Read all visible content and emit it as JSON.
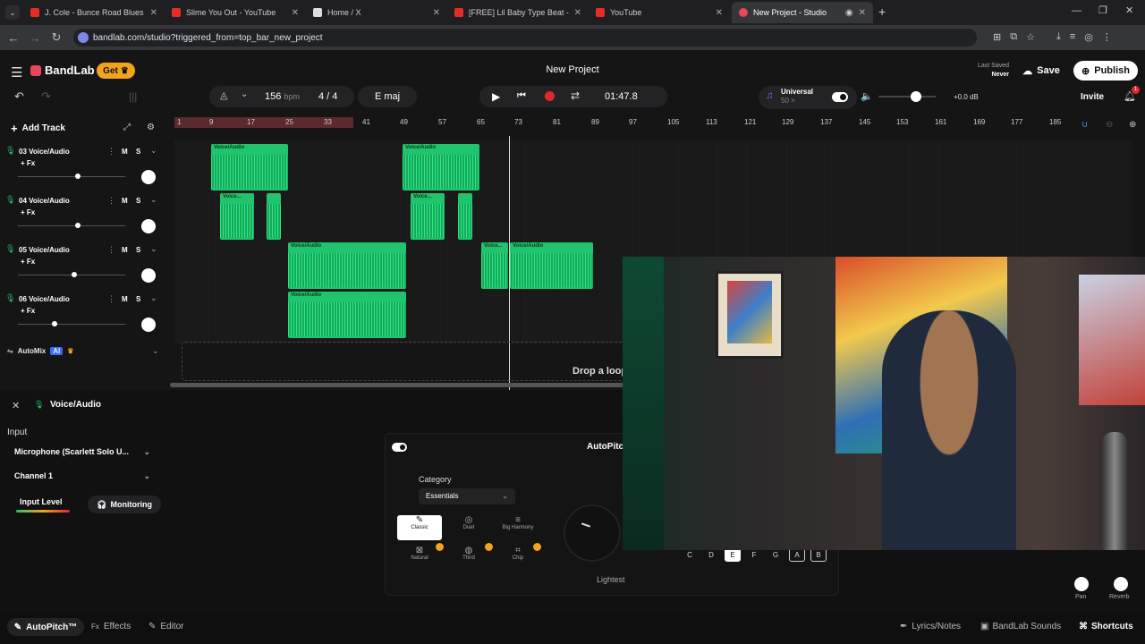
{
  "browser": {
    "tabs": [
      {
        "title": "J. Cole - Bunce Road Blues [Ins",
        "color": "#e52d27"
      },
      {
        "title": "Slime You Out - YouTube",
        "color": "#e52d27"
      },
      {
        "title": "Home / X",
        "color": "#dddddd"
      },
      {
        "title": "[FREE] Lil Baby Type Beat - \"Ne",
        "color": "#e52d27"
      },
      {
        "title": "YouTube",
        "color": "#e52d27"
      },
      {
        "title": "New Project - Studio",
        "color": "#e8465b"
      }
    ],
    "url": "bandlab.com/studio?triggered_from=top_bar_new_project"
  },
  "header": {
    "logo": "BandLab",
    "get_label": "Get",
    "project_title": "New Project",
    "last_saved_label": "Last Saved",
    "last_saved_value": "Never",
    "save_label": "Save",
    "publish_label": "Publish"
  },
  "transport": {
    "bpm": "156",
    "bpm_unit": "bpm",
    "time_sig": "4 / 4",
    "key": "E maj",
    "time": "01:47.8",
    "preset_name": "Universal",
    "preset_sub": "50 >",
    "volume_db": "+0.0 dB",
    "invite_label": "Invite",
    "notif_count": "1"
  },
  "tracks_panel": {
    "add_track_label": "Add Track",
    "automix_label": "AutoMix",
    "automix_badge": "AI",
    "fx_label": "+ Fx",
    "mute": "M",
    "solo": "S",
    "tracks": [
      {
        "name": "03  Voice/Audio"
      },
      {
        "name": "04  Voice/Audio"
      },
      {
        "name": "05  Voice/Audio"
      },
      {
        "name": "06  Voice/Audio"
      }
    ]
  },
  "ruler": [
    "1",
    "9",
    "17",
    "25",
    "33",
    "41",
    "49",
    "57",
    "65",
    "73",
    "81",
    "89",
    "97",
    "105",
    "113",
    "121",
    "129",
    "137",
    "145",
    "153",
    "161",
    "169",
    "177",
    "185"
  ],
  "clip_labels": {
    "voice_audio": "Voice/Audio",
    "voice_short": "Voice..."
  },
  "drop_loop_label": "Drop a loop",
  "bottom_panel": {
    "track_title": "Voice/Audio",
    "input_label": "Input",
    "mic_value": "Microphone (Scarlett Solo U...",
    "channel_value": "Channel 1",
    "input_level_label": "Input Level",
    "monitoring_label": "Monitoring",
    "autopitch_title": "AutoPitch",
    "category_label": "Category",
    "category_value": "Essentials",
    "effects": [
      {
        "label": "Classic"
      },
      {
        "label": "Duet"
      },
      {
        "label": "Big Harmony"
      },
      {
        "label": "Natural"
      },
      {
        "label": "Third"
      },
      {
        "label": "Chip"
      }
    ],
    "amount_label": "Lightest",
    "keys": [
      "C",
      "D",
      "E",
      "F",
      "G",
      "A",
      "B"
    ],
    "pan_label": "Pan",
    "reverb_label": "Reverb"
  },
  "footer": {
    "autopitch": "AutoPitch™",
    "effects": "Effects",
    "editor": "Editor",
    "lyrics": "Lyrics/Notes",
    "sounds": "BandLab Sounds",
    "shortcuts": "Shortcuts"
  },
  "colors": {
    "accent_green": "#1fc46d",
    "record_red": "#e0282d",
    "get_orange": "#f2a41c",
    "loop_region": "#5a2a2e"
  }
}
